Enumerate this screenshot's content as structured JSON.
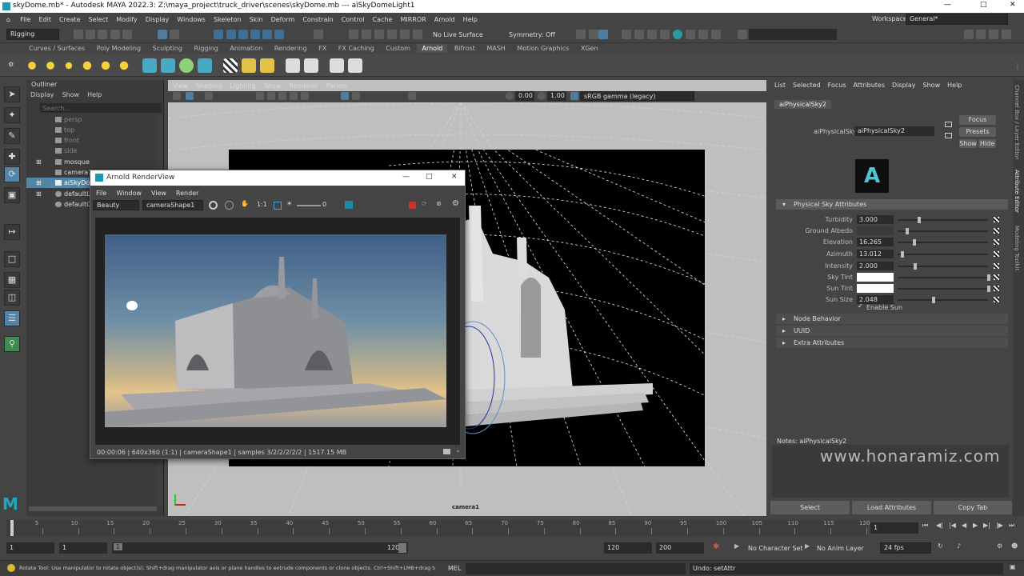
{
  "window": {
    "title": "skyDome.mb* - Autodesk MAYA 2022.3: Z:\\maya_project\\truck_driver\\scenes\\skyDome.mb  ---  aiSkyDomeLight1",
    "workspace_label": "Workspace:",
    "workspace_value": "General*"
  },
  "menubar": [
    "File",
    "Edit",
    "Create",
    "Select",
    "Modify",
    "Display",
    "Windows",
    "Skeleton",
    "Skin",
    "Deform",
    "Constrain",
    "Control",
    "Cache",
    "MIRROR",
    "Arnold",
    "Help"
  ],
  "statusline": {
    "mode": "Rigging",
    "live_surface": "No Live Surface",
    "symmetry": "Symmetry: Off"
  },
  "shelf_tabs": [
    "Curves / Surfaces",
    "Poly Modeling",
    "Sculpting",
    "Rigging",
    "Animation",
    "Rendering",
    "FX",
    "FX Caching",
    "Custom",
    "Arnold",
    "Bifrost",
    "MASH",
    "Motion Graphics",
    "XGen"
  ],
  "shelf_active": "Arnold",
  "outliner": {
    "title": "Outliner",
    "menu": [
      "Display",
      "Show",
      "Help"
    ],
    "search_placeholder": "Search...",
    "items": [
      {
        "label": "persp",
        "dim": true
      },
      {
        "label": "top",
        "dim": true
      },
      {
        "label": "front",
        "dim": true
      },
      {
        "label": "side",
        "dim": true
      },
      {
        "label": "mosque",
        "dim": false
      },
      {
        "label": "camera1",
        "dim": false
      },
      {
        "label": "aiSkyDomeL",
        "dim": false,
        "selected": true
      },
      {
        "label": "defaultLight",
        "dim": false
      },
      {
        "label": "defaultObje",
        "dim": false
      }
    ]
  },
  "viewport": {
    "menu": [
      "View",
      "Shading",
      "Lighting",
      "Show",
      "Renderer",
      "Panels"
    ],
    "exposure": "0.00",
    "gamma": "1.00",
    "colorspace": "sRGB gamma (legacy)",
    "camera_label": "camera1"
  },
  "renderview": {
    "title": "Arnold RenderView",
    "menu": [
      "File",
      "Window",
      "View",
      "Render"
    ],
    "aov": "Beauty",
    "camera": "cameraShape1",
    "ratio": "1:1",
    "exposure": "0",
    "status": "00:00:06 | 640x360 (1:1) | cameraShape1  | samples 3/2/2/2/2/2 | 1517.15 MB"
  },
  "attribute_editor": {
    "menu": [
      "List",
      "Selected",
      "Focus",
      "Attributes",
      "Display",
      "Show",
      "Help"
    ],
    "tab": "aiPhysicalSky2",
    "node_label": "aiPhysicalSky:",
    "node_value": "aiPhysicalSky2",
    "focus": "Focus",
    "presets": "Presets",
    "show": "Show",
    "hide": "Hide",
    "section_main": "Physical Sky Attributes",
    "attrs": [
      {
        "label": "Turbidity",
        "value": "3.000",
        "level": 0.23
      },
      {
        "label": "Ground Albedo",
        "value": "",
        "level": 0.1
      },
      {
        "label": "Elevation",
        "value": "16.265",
        "level": 0.18
      },
      {
        "label": "Azimuth",
        "value": "13.012",
        "level": 0.04
      },
      {
        "label": "Intensity",
        "value": "2.000",
        "level": 0.19
      },
      {
        "label": "Sky Tint",
        "value": "",
        "level": 1.0
      },
      {
        "label": "Sun Tint",
        "value": "",
        "level": 1.0
      },
      {
        "label": "Sun Size",
        "value": "2.048",
        "level": 0.39
      }
    ],
    "enable_sun": "Enable Sun",
    "sections": [
      "Node Behavior",
      "UUID",
      "Extra Attributes"
    ],
    "notes": "Notes: aiPhysicalSky2",
    "buttons": [
      "Select",
      "Load Attributes",
      "Copy Tab"
    ],
    "side_tabs": [
      "Channel Box / Layer Editor",
      "Attribute Editor",
      "Modeling Toolkit"
    ]
  },
  "timeline": {
    "ticks": [
      "5",
      "10",
      "15",
      "20",
      "25",
      "30",
      "35",
      "40",
      "45",
      "50",
      "55",
      "60",
      "65",
      "70",
      "75",
      "80",
      "85",
      "90",
      "95",
      "100",
      "105",
      "110",
      "115",
      "120"
    ],
    "current": "1"
  },
  "range": {
    "start": "1",
    "start2": "1",
    "slider_start": "1",
    "slider_end": "120",
    "end": "120",
    "end2": "200",
    "character": "No Character Set",
    "anim_layer": "No Anim Layer",
    "fps": "24 fps"
  },
  "cmdline": {
    "help": "Rotate Tool: Use manipulator to rotate object(s). Shift+drag manipulator axis or plane handles to extrude components or clone objects. Ctrl+Shift+LMB+drag to constrain rotatio",
    "lang": "MEL",
    "result": "Undo: setAttr"
  },
  "watermark": "www.honaramiz.com"
}
